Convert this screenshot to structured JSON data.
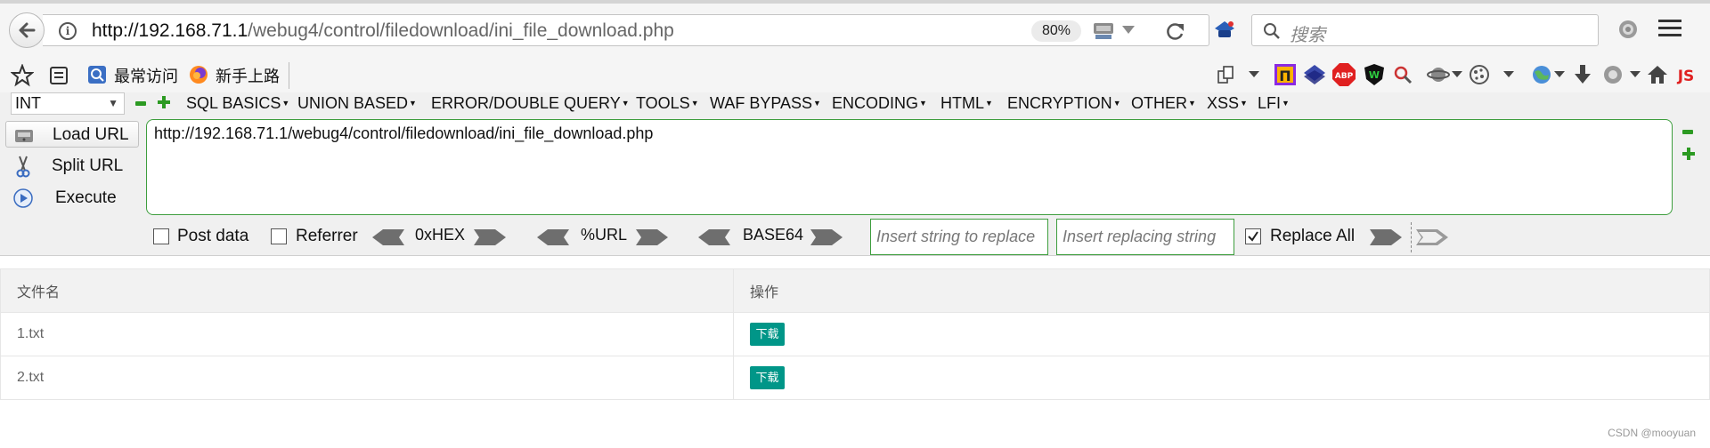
{
  "navbar": {
    "url_host": "http://192.168.71.1",
    "url_path": "/webug4/control/filedownload/ini_file_download.php",
    "zoom": "80%",
    "search_placeholder": "搜索"
  },
  "bookmarks": {
    "items": [
      {
        "label": "最常访问"
      },
      {
        "label": "新手上路"
      }
    ]
  },
  "hackbar": {
    "select_value": "INT",
    "menus": [
      {
        "label": "SQL BASICS"
      },
      {
        "label": "UNION BASED"
      },
      {
        "label": "ERROR/DOUBLE QUERY"
      },
      {
        "label": "TOOLS"
      },
      {
        "label": "WAF BYPASS"
      },
      {
        "label": "ENCODING"
      },
      {
        "label": "HTML"
      },
      {
        "label": "ENCRYPTION"
      },
      {
        "label": "OTHER"
      },
      {
        "label": "XSS"
      },
      {
        "label": "LFI"
      }
    ],
    "buttons": {
      "load": "Load URL",
      "split": "Split URL",
      "execute": "Execute"
    },
    "url_value": "http://192.168.71.1/webug4/control/filedownload/ini_file_download.php",
    "post_data": "Post data",
    "referrer": "Referrer",
    "hex": "0xHEX",
    "url_enc": "%URL",
    "base64": "BASE64",
    "insert_placeholder": "Insert string to replace",
    "replacing_placeholder": "Insert replacing string",
    "replace_all": "Replace All"
  },
  "table": {
    "headers": [
      "文件名",
      "操作"
    ],
    "rows": [
      {
        "name": "1.txt",
        "action": "下载"
      },
      {
        "name": "2.txt",
        "action": "下载"
      }
    ]
  },
  "watermark": "CSDN @mooyuan",
  "colors": {
    "download_button": "#009688",
    "hackbar_border": "#3e9e3e"
  }
}
